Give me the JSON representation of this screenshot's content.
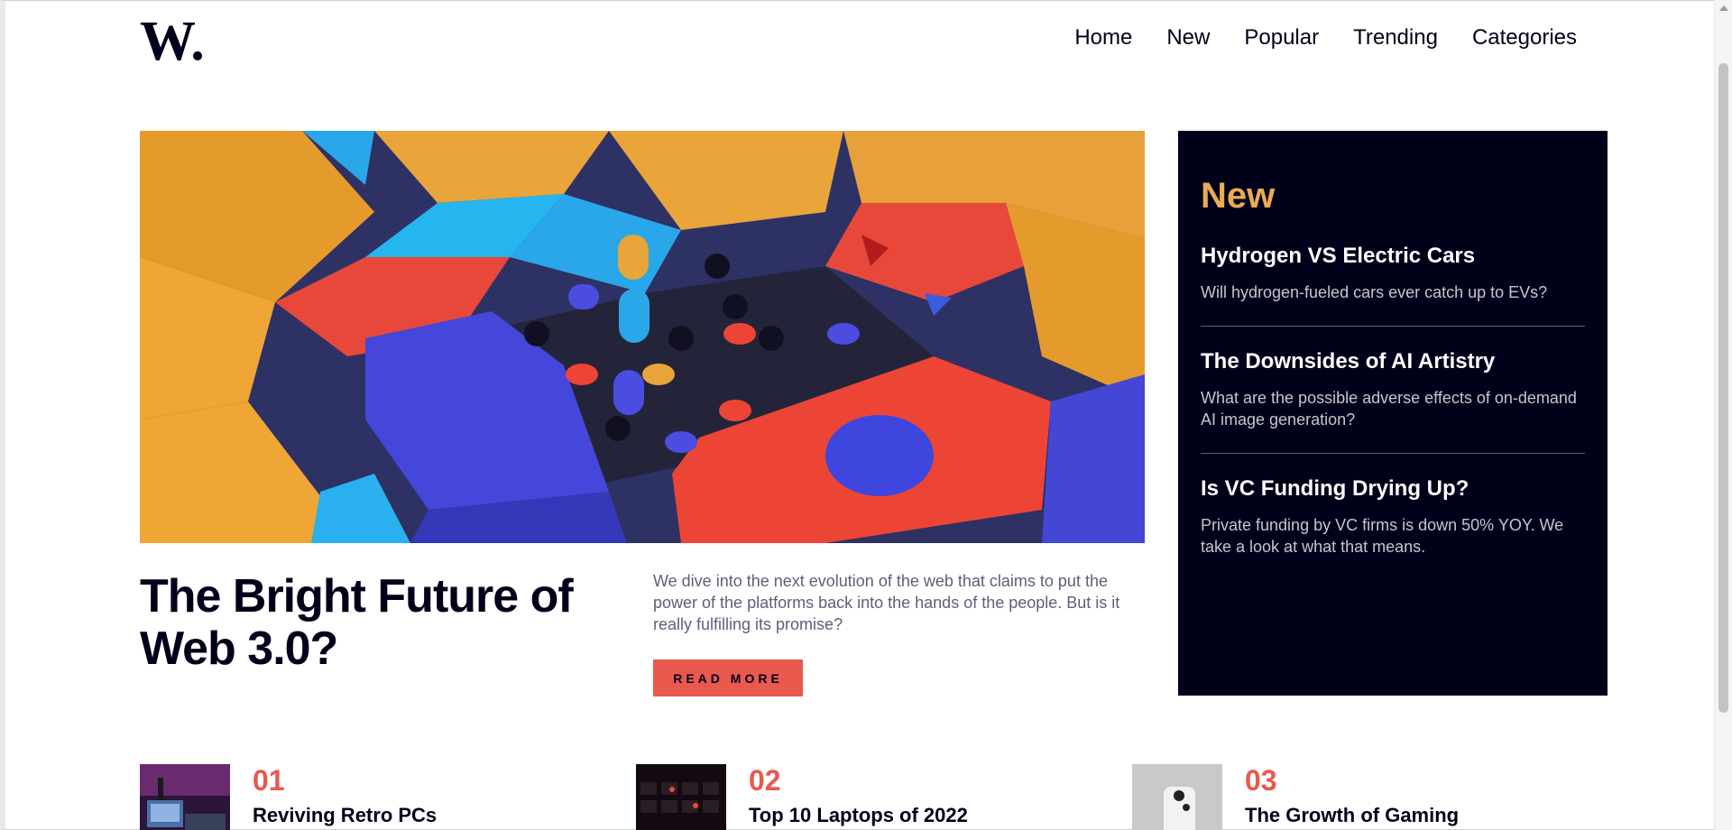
{
  "brand": {
    "logo_text": "W."
  },
  "nav": {
    "items": [
      {
        "label": "Home"
      },
      {
        "label": "New"
      },
      {
        "label": "Popular"
      },
      {
        "label": "Trending"
      },
      {
        "label": "Categories"
      }
    ]
  },
  "hero": {
    "title": "The Bright Future of Web 3.0?",
    "description": "We dive into the next evolution of the web that claims to put the power of the platforms back into the hands of the people. But is it really fulfilling its promise?",
    "button_label": "READ MORE"
  },
  "new_panel": {
    "heading": "New",
    "items": [
      {
        "title": "Hydrogen VS Electric Cars",
        "desc": "Will hydrogen-fueled cars ever catch up to EVs?"
      },
      {
        "title": "The Downsides of AI Artistry",
        "desc": "What are the possible adverse effects of on-demand AI image generation?"
      },
      {
        "title": "Is VC Funding Drying Up?",
        "desc": "Private funding by VC firms is down 50% YOY. We take a look at what that means."
      }
    ]
  },
  "articles": [
    {
      "number": "01",
      "title": "Reviving Retro PCs"
    },
    {
      "number": "02",
      "title": "Top 10 Laptops of 2022"
    },
    {
      "number": "03",
      "title": "The Growth of Gaming"
    }
  ],
  "colors": {
    "dark_blue": "#00001a",
    "soft_orange": "#e9ab53",
    "soft_red": "#e9594e",
    "grayish_blue": "#5d5f79"
  }
}
